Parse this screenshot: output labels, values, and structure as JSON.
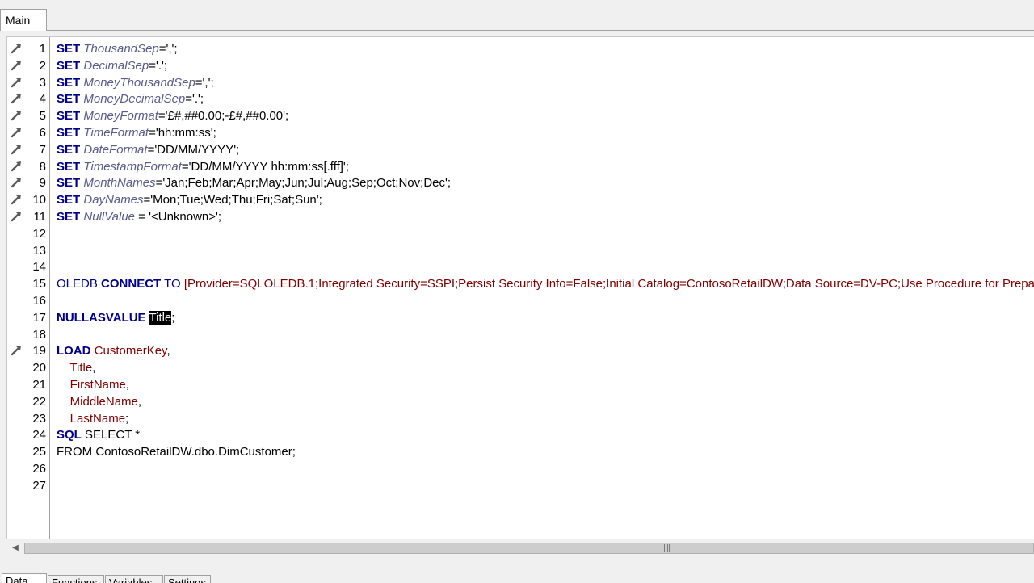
{
  "tabs": {
    "main": "Main"
  },
  "editor": {
    "lines": [
      {
        "n": "1",
        "marker": true,
        "tokens": [
          {
            "c": "kw",
            "t": "SET"
          },
          {
            "c": "",
            "t": " "
          },
          {
            "c": "var",
            "t": "ThousandSep"
          },
          {
            "c": "",
            "t": "=',';"
          }
        ]
      },
      {
        "n": "2",
        "marker": true,
        "tokens": [
          {
            "c": "kw",
            "t": "SET"
          },
          {
            "c": "",
            "t": " "
          },
          {
            "c": "var",
            "t": "DecimalSep"
          },
          {
            "c": "",
            "t": "='.';"
          }
        ]
      },
      {
        "n": "3",
        "marker": true,
        "tokens": [
          {
            "c": "kw",
            "t": "SET"
          },
          {
            "c": "",
            "t": " "
          },
          {
            "c": "var",
            "t": "MoneyThousandSep"
          },
          {
            "c": "",
            "t": "=',';"
          }
        ]
      },
      {
        "n": "4",
        "marker": true,
        "tokens": [
          {
            "c": "kw",
            "t": "SET"
          },
          {
            "c": "",
            "t": " "
          },
          {
            "c": "var",
            "t": "MoneyDecimalSep"
          },
          {
            "c": "",
            "t": "='.';"
          }
        ]
      },
      {
        "n": "5",
        "marker": true,
        "tokens": [
          {
            "c": "kw",
            "t": "SET"
          },
          {
            "c": "",
            "t": " "
          },
          {
            "c": "var",
            "t": "MoneyFormat"
          },
          {
            "c": "",
            "t": "='£#,##0.00;-£#,##0.00';"
          }
        ]
      },
      {
        "n": "6",
        "marker": true,
        "tokens": [
          {
            "c": "kw",
            "t": "SET"
          },
          {
            "c": "",
            "t": " "
          },
          {
            "c": "var",
            "t": "TimeFormat"
          },
          {
            "c": "",
            "t": "='hh:mm:ss';"
          }
        ]
      },
      {
        "n": "7",
        "marker": true,
        "tokens": [
          {
            "c": "kw",
            "t": "SET"
          },
          {
            "c": "",
            "t": " "
          },
          {
            "c": "var",
            "t": "DateFormat"
          },
          {
            "c": "",
            "t": "='DD/MM/YYYY';"
          }
        ]
      },
      {
        "n": "8",
        "marker": true,
        "tokens": [
          {
            "c": "kw",
            "t": "SET"
          },
          {
            "c": "",
            "t": " "
          },
          {
            "c": "var",
            "t": "TimestampFormat"
          },
          {
            "c": "",
            "t": "='DD/MM/YYYY hh:mm:ss[.fff]';"
          }
        ]
      },
      {
        "n": "9",
        "marker": true,
        "tokens": [
          {
            "c": "kw",
            "t": "SET"
          },
          {
            "c": "",
            "t": " "
          },
          {
            "c": "var",
            "t": "MonthNames"
          },
          {
            "c": "",
            "t": "='Jan;Feb;Mar;Apr;May;Jun;Jul;Aug;Sep;Oct;Nov;Dec';"
          }
        ]
      },
      {
        "n": "10",
        "marker": true,
        "tokens": [
          {
            "c": "kw",
            "t": "SET"
          },
          {
            "c": "",
            "t": " "
          },
          {
            "c": "var",
            "t": "DayNames"
          },
          {
            "c": "",
            "t": "='Mon;Tue;Wed;Thu;Fri;Sat;Sun';"
          }
        ]
      },
      {
        "n": "11",
        "marker": true,
        "tokens": [
          {
            "c": "kw",
            "t": "SET"
          },
          {
            "c": "",
            "t": " "
          },
          {
            "c": "var",
            "t": "NullValue"
          },
          {
            "c": "",
            "t": " = '<Unknown>';"
          }
        ]
      },
      {
        "n": "12",
        "marker": false,
        "tokens": []
      },
      {
        "n": "13",
        "marker": false,
        "tokens": []
      },
      {
        "n": "14",
        "marker": false,
        "tokens": []
      },
      {
        "n": "15",
        "marker": false,
        "tokens": [
          {
            "c": "kw2",
            "t": "OLEDB "
          },
          {
            "c": "kw",
            "t": "CONNECT"
          },
          {
            "c": "",
            "t": " "
          },
          {
            "c": "kw2",
            "t": "TO"
          },
          {
            "c": "",
            "t": " "
          },
          {
            "c": "fld",
            "t": "[Provider=SQLOLEDB.1;Integrated Security=SSPI;Persist Security Info=False;Initial Catalog=ContosoRetailDW;Data Source=DV-PC;Use Procedure for Prepa"
          }
        ]
      },
      {
        "n": "16",
        "marker": false,
        "tokens": []
      },
      {
        "n": "17",
        "marker": false,
        "tokens": [
          {
            "c": "kw",
            "t": "NULLASVALUE"
          },
          {
            "c": "",
            "t": " "
          },
          {
            "c": "sel",
            "t": "Title"
          },
          {
            "c": "",
            "t": ";"
          }
        ]
      },
      {
        "n": "18",
        "marker": false,
        "tokens": []
      },
      {
        "n": "19",
        "marker": true,
        "tokens": [
          {
            "c": "kw",
            "t": "LOAD"
          },
          {
            "c": "",
            "t": " "
          },
          {
            "c": "fld",
            "t": "CustomerKey"
          },
          {
            "c": "",
            "t": ","
          }
        ]
      },
      {
        "n": "20",
        "marker": false,
        "tokens": [
          {
            "c": "",
            "t": "    "
          },
          {
            "c": "fld",
            "t": "Title"
          },
          {
            "c": "",
            "t": ","
          }
        ]
      },
      {
        "n": "21",
        "marker": false,
        "tokens": [
          {
            "c": "",
            "t": "    "
          },
          {
            "c": "fld",
            "t": "FirstName"
          },
          {
            "c": "",
            "t": ","
          }
        ]
      },
      {
        "n": "22",
        "marker": false,
        "tokens": [
          {
            "c": "",
            "t": "    "
          },
          {
            "c": "fld",
            "t": "MiddleName"
          },
          {
            "c": "",
            "t": ","
          }
        ]
      },
      {
        "n": "23",
        "marker": false,
        "tokens": [
          {
            "c": "",
            "t": "    "
          },
          {
            "c": "fld",
            "t": "LastName"
          },
          {
            "c": "",
            "t": ";"
          }
        ]
      },
      {
        "n": "24",
        "marker": false,
        "tokens": [
          {
            "c": "kw",
            "t": "SQL"
          },
          {
            "c": "",
            "t": " SELECT *"
          }
        ]
      },
      {
        "n": "25",
        "marker": false,
        "tokens": [
          {
            "c": "",
            "t": "FROM ContosoRetailDW.dbo.DimCustomer;"
          }
        ]
      },
      {
        "n": "26",
        "marker": false,
        "tokens": []
      },
      {
        "n": "27",
        "marker": false,
        "tokens": []
      }
    ],
    "marker_icon": "wrench-icon"
  },
  "bottom_tabs": [
    {
      "label": "Data",
      "active": true
    },
    {
      "label": "Functions",
      "active": false
    },
    {
      "label": "Variables",
      "active": false
    },
    {
      "label": "Settings",
      "active": false
    }
  ]
}
